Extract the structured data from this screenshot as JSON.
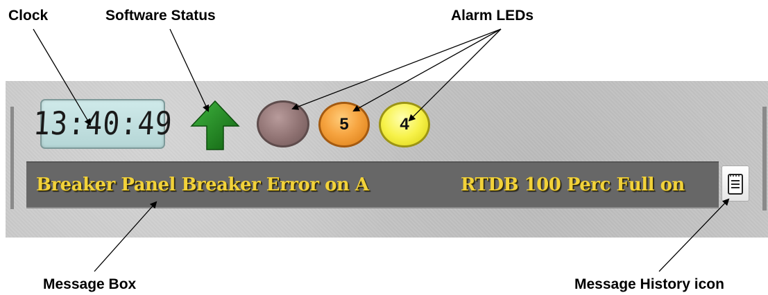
{
  "callouts": {
    "clock": "Clock",
    "software_status": "Software Status",
    "alarm_leds": "Alarm LEDs",
    "message_box": "Message Box",
    "message_history_icon": "Message History icon"
  },
  "clock": {
    "time": "13:40:49"
  },
  "software_status": {
    "icon": "up-arrow-icon",
    "color": "#1f8a1f"
  },
  "alarm_leds": [
    {
      "count": "",
      "color": "#8f7272"
    },
    {
      "count": "5",
      "color": "#f6a440"
    },
    {
      "count": "4",
      "color": "#f7f24a"
    }
  ],
  "message_box": {
    "messages": [
      "Breaker Panel Breaker Error on A",
      "RTDB 100 Perc Full on"
    ],
    "text_color": "#f2d23a"
  },
  "message_history": {
    "icon": "notepad-icon"
  }
}
